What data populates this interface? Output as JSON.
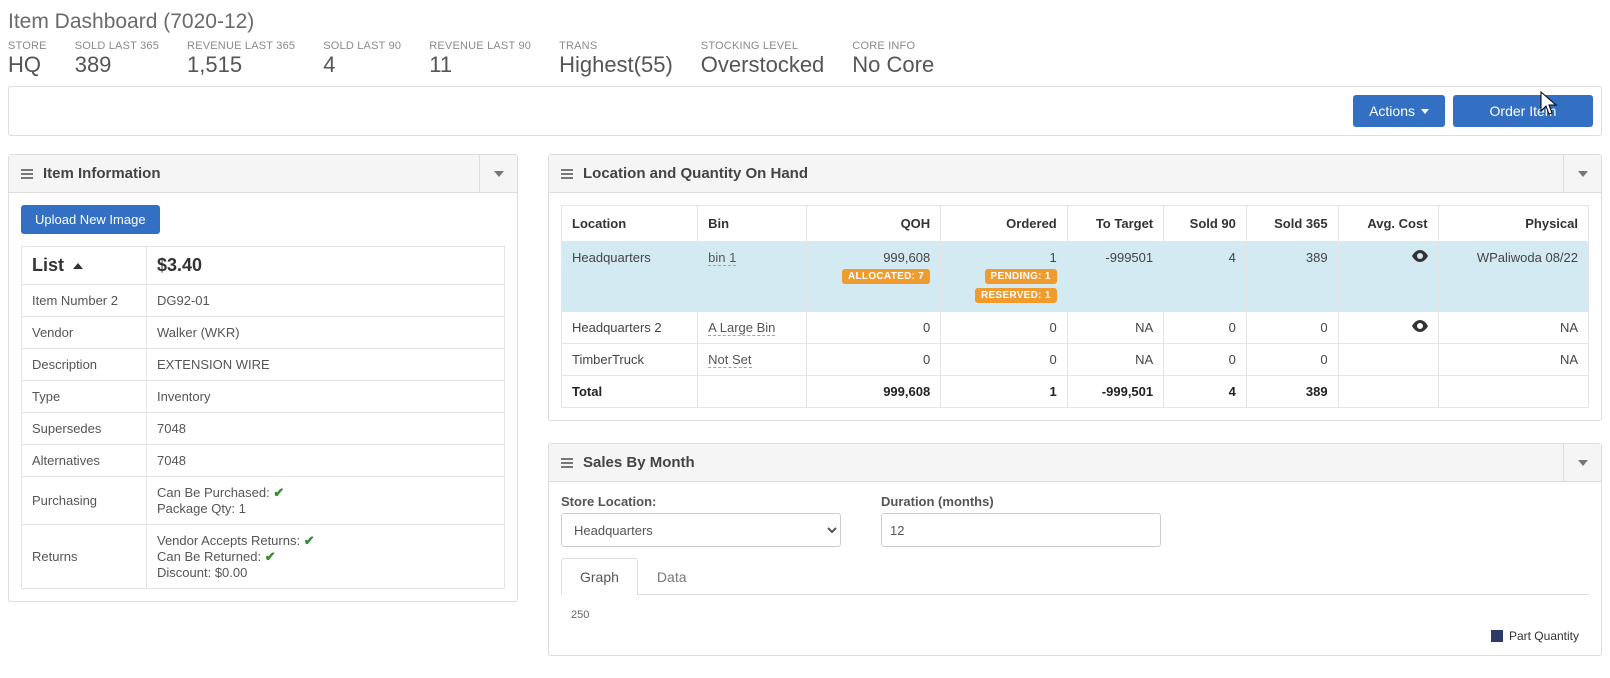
{
  "page": {
    "title": "Item Dashboard (7020-12)"
  },
  "stats": {
    "store": {
      "label": "STORE",
      "value": "HQ"
    },
    "sold365": {
      "label": "SOLD LAST 365",
      "value": "389"
    },
    "rev365": {
      "label": "REVENUE LAST 365",
      "value": "1,515"
    },
    "sold90": {
      "label": "SOLD LAST 90",
      "value": "4"
    },
    "rev90": {
      "label": "REVENUE LAST 90",
      "value": "11"
    },
    "trans": {
      "label": "TRANS",
      "value": "Highest(55)"
    },
    "stocking": {
      "label": "STOCKING LEVEL",
      "value": "Overstocked"
    },
    "core": {
      "label": "CORE INFO",
      "value": "No Core"
    }
  },
  "toolbar": {
    "actions_label": "Actions",
    "order_label": "Order Item"
  },
  "item_info": {
    "panel_title": "Item Information",
    "upload_label": "Upload New Image",
    "list_label": "List",
    "price": "$3.40",
    "rows": {
      "item_no2": {
        "k": "Item Number 2",
        "v": "DG92-01"
      },
      "vendor": {
        "k": "Vendor",
        "v": "Walker (WKR)"
      },
      "description": {
        "k": "Description",
        "v": "EXTENSION WIRE"
      },
      "type": {
        "k": "Type",
        "v": "Inventory"
      },
      "supersedes": {
        "k": "Supersedes",
        "v": "7048"
      },
      "alternatives": {
        "k": "Alternatives",
        "v": "7048"
      }
    },
    "purchasing": {
      "k": "Purchasing",
      "can_be_purchased_label": "Can Be Purchased:",
      "package_qty_label": "Package Qty:",
      "package_qty_value": "1"
    },
    "returns": {
      "k": "Returns",
      "vendor_accepts_label": "Vendor Accepts Returns:",
      "can_be_returned_label": "Can Be Returned:",
      "discount_label": "Discount:",
      "discount_value": "$0.00"
    }
  },
  "loc_qoh": {
    "panel_title": "Location and Quantity On Hand",
    "headers": {
      "location": "Location",
      "bin": "Bin",
      "qoh": "QOH",
      "ordered": "Ordered",
      "to_target": "To Target",
      "sold90": "Sold 90",
      "sold365": "Sold 365",
      "avg_cost": "Avg. Cost",
      "physical": "Physical"
    },
    "rows": [
      {
        "location": "Headquarters",
        "bin": "bin 1",
        "qoh": "999,608",
        "qoh_badge": "ALLOCATED: 7",
        "ordered": "1",
        "ordered_badge1": "PENDING: 1",
        "ordered_badge2": "RESERVED: 1",
        "to_target": "-999501",
        "sold90": "4",
        "sold365": "389",
        "avg_cost_icon": true,
        "physical": "WPaliwoda 08/22",
        "selected": true
      },
      {
        "location": "Headquarters 2",
        "bin": "A Large Bin",
        "qoh": "0",
        "ordered": "0",
        "to_target": "NA",
        "sold90": "0",
        "sold365": "0",
        "avg_cost_icon": true,
        "physical": "NA"
      },
      {
        "location": "TimberTruck",
        "bin": "Not Set",
        "qoh": "0",
        "ordered": "0",
        "to_target": "NA",
        "sold90": "0",
        "sold365": "0",
        "avg_cost_icon": false,
        "physical": "NA"
      }
    ],
    "total": {
      "label": "Total",
      "qoh": "999,608",
      "ordered": "1",
      "to_target": "-999,501",
      "sold90": "4",
      "sold365": "389"
    }
  },
  "sales_by_month": {
    "panel_title": "Sales By Month",
    "store_label": "Store Location:",
    "store_value": "Headquarters",
    "duration_label": "Duration (months)",
    "duration_value": "12",
    "tabs": {
      "graph": "Graph",
      "data": "Data"
    },
    "y_tick": "250",
    "legend_label": "Part Quantity"
  },
  "chart_data": {
    "type": "bar",
    "title": "Sales By Month",
    "ylabel": "Part Quantity",
    "ylim": [
      0,
      250
    ],
    "series": [
      {
        "name": "Part Quantity",
        "values": []
      }
    ],
    "categories": []
  }
}
